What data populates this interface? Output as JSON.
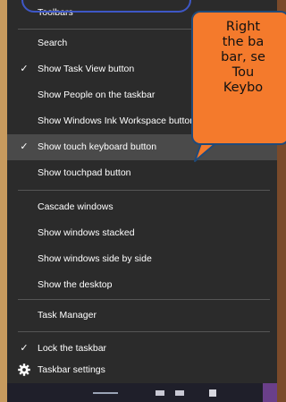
{
  "menu": {
    "items": [
      {
        "label": "Toolbars",
        "checked": false
      },
      {
        "label": "Search",
        "checked": false
      },
      {
        "label": "Show Task View button",
        "checked": true
      },
      {
        "label": "Show People on the taskbar",
        "checked": false
      },
      {
        "label": "Show Windows Ink Workspace button",
        "checked": false
      },
      {
        "label": "Show touch keyboard button",
        "checked": true
      },
      {
        "label": "Show touchpad button",
        "checked": false
      },
      {
        "label": "Cascade windows",
        "checked": false
      },
      {
        "label": "Show windows stacked",
        "checked": false
      },
      {
        "label": "Show windows side by side",
        "checked": false
      },
      {
        "label": "Show the desktop",
        "checked": false
      },
      {
        "label": "Task Manager",
        "checked": false
      },
      {
        "label": "Lock the taskbar",
        "checked": true
      },
      {
        "label": "Taskbar settings",
        "icon": "gear-icon"
      }
    ],
    "check_glyph": "✓"
  },
  "callout": {
    "lines": [
      "Right",
      "the ba",
      "bar, se",
      "Tou",
      "Keybo"
    ]
  },
  "colors": {
    "menu_bg": "#2b2b2b",
    "highlight": "#4a4a4a",
    "callout_fill": "#f47a2c",
    "callout_border": "#1f4a7a",
    "outline": "#3e57c6"
  }
}
